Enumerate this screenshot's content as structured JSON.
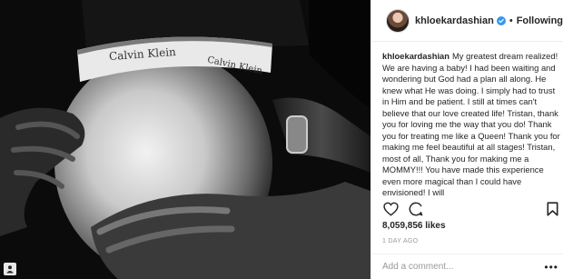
{
  "photo": {
    "waistband_brand": "Calvin Klein",
    "corner_icon": "user-tag-icon"
  },
  "post_header": {
    "username": "khloekardashian",
    "verified_icon": "verified-badge-icon",
    "separator": "•",
    "follow_status": "Following"
  },
  "caption": {
    "username": "khloekardashian",
    "text": "My greatest dream realized! We are having a baby! I had been waiting and wondering but God had a plan all along. He knew what He was doing. I simply had to trust in Him and be patient. I still at times can't believe that our love created life! Tristan, thank you for loving me the way that you do! Thank you for treating me like a Queen! Thank you for making me feel beautiful at all stages! Tristan, most of all, Thank you for making me a MOMMY!!! You have made this experience even more magical than I could have envisioned! I will"
  },
  "actions": {
    "like_icon": "heart-icon",
    "comment_icon": "comment-bubble-icon",
    "save_icon": "bookmark-icon"
  },
  "likes": "8,059,856 likes",
  "timestamp": "1 DAY AGO",
  "comment_box": {
    "placeholder": "Add a comment...",
    "more": "•••"
  },
  "colors": {
    "verified_blue": "#3897f0",
    "text": "#262626",
    "muted": "#999999",
    "divider": "#efefef"
  }
}
